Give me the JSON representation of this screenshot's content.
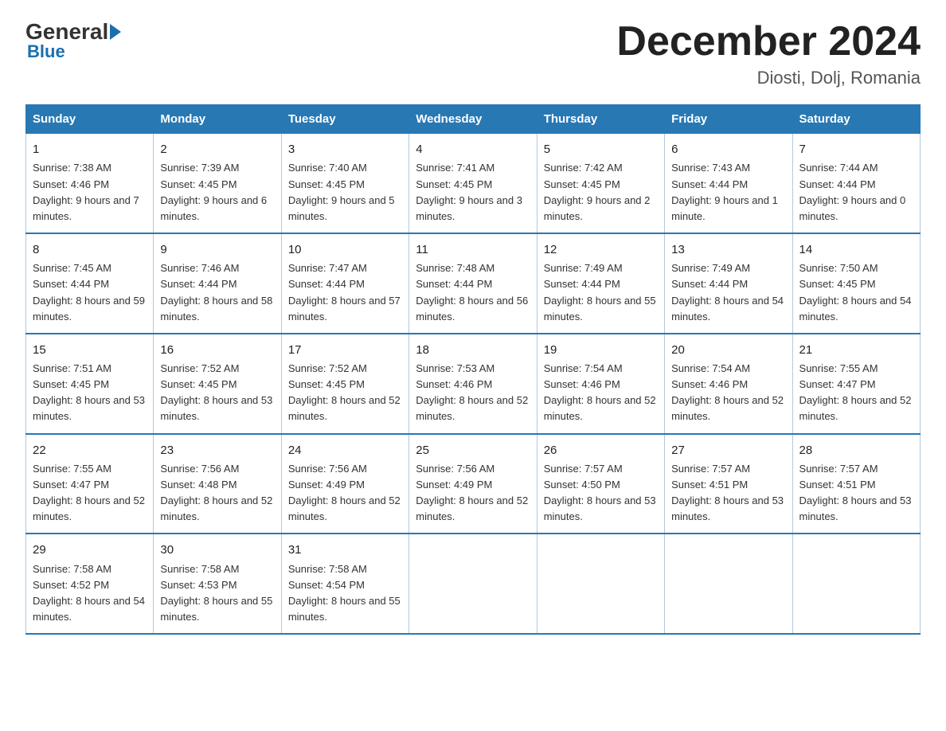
{
  "header": {
    "logo_general": "General",
    "logo_blue": "Blue",
    "title": "December 2024",
    "location": "Diosti, Dolj, Romania"
  },
  "days_of_week": [
    "Sunday",
    "Monday",
    "Tuesday",
    "Wednesday",
    "Thursday",
    "Friday",
    "Saturday"
  ],
  "weeks": [
    [
      {
        "day": "1",
        "sunrise": "7:38 AM",
        "sunset": "4:46 PM",
        "daylight": "9 hours and 7 minutes."
      },
      {
        "day": "2",
        "sunrise": "7:39 AM",
        "sunset": "4:45 PM",
        "daylight": "9 hours and 6 minutes."
      },
      {
        "day": "3",
        "sunrise": "7:40 AM",
        "sunset": "4:45 PM",
        "daylight": "9 hours and 5 minutes."
      },
      {
        "day": "4",
        "sunrise": "7:41 AM",
        "sunset": "4:45 PM",
        "daylight": "9 hours and 3 minutes."
      },
      {
        "day": "5",
        "sunrise": "7:42 AM",
        "sunset": "4:45 PM",
        "daylight": "9 hours and 2 minutes."
      },
      {
        "day": "6",
        "sunrise": "7:43 AM",
        "sunset": "4:44 PM",
        "daylight": "9 hours and 1 minute."
      },
      {
        "day": "7",
        "sunrise": "7:44 AM",
        "sunset": "4:44 PM",
        "daylight": "9 hours and 0 minutes."
      }
    ],
    [
      {
        "day": "8",
        "sunrise": "7:45 AM",
        "sunset": "4:44 PM",
        "daylight": "8 hours and 59 minutes."
      },
      {
        "day": "9",
        "sunrise": "7:46 AM",
        "sunset": "4:44 PM",
        "daylight": "8 hours and 58 minutes."
      },
      {
        "day": "10",
        "sunrise": "7:47 AM",
        "sunset": "4:44 PM",
        "daylight": "8 hours and 57 minutes."
      },
      {
        "day": "11",
        "sunrise": "7:48 AM",
        "sunset": "4:44 PM",
        "daylight": "8 hours and 56 minutes."
      },
      {
        "day": "12",
        "sunrise": "7:49 AM",
        "sunset": "4:44 PM",
        "daylight": "8 hours and 55 minutes."
      },
      {
        "day": "13",
        "sunrise": "7:49 AM",
        "sunset": "4:44 PM",
        "daylight": "8 hours and 54 minutes."
      },
      {
        "day": "14",
        "sunrise": "7:50 AM",
        "sunset": "4:45 PM",
        "daylight": "8 hours and 54 minutes."
      }
    ],
    [
      {
        "day": "15",
        "sunrise": "7:51 AM",
        "sunset": "4:45 PM",
        "daylight": "8 hours and 53 minutes."
      },
      {
        "day": "16",
        "sunrise": "7:52 AM",
        "sunset": "4:45 PM",
        "daylight": "8 hours and 53 minutes."
      },
      {
        "day": "17",
        "sunrise": "7:52 AM",
        "sunset": "4:45 PM",
        "daylight": "8 hours and 52 minutes."
      },
      {
        "day": "18",
        "sunrise": "7:53 AM",
        "sunset": "4:46 PM",
        "daylight": "8 hours and 52 minutes."
      },
      {
        "day": "19",
        "sunrise": "7:54 AM",
        "sunset": "4:46 PM",
        "daylight": "8 hours and 52 minutes."
      },
      {
        "day": "20",
        "sunrise": "7:54 AM",
        "sunset": "4:46 PM",
        "daylight": "8 hours and 52 minutes."
      },
      {
        "day": "21",
        "sunrise": "7:55 AM",
        "sunset": "4:47 PM",
        "daylight": "8 hours and 52 minutes."
      }
    ],
    [
      {
        "day": "22",
        "sunrise": "7:55 AM",
        "sunset": "4:47 PM",
        "daylight": "8 hours and 52 minutes."
      },
      {
        "day": "23",
        "sunrise": "7:56 AM",
        "sunset": "4:48 PM",
        "daylight": "8 hours and 52 minutes."
      },
      {
        "day": "24",
        "sunrise": "7:56 AM",
        "sunset": "4:49 PM",
        "daylight": "8 hours and 52 minutes."
      },
      {
        "day": "25",
        "sunrise": "7:56 AM",
        "sunset": "4:49 PM",
        "daylight": "8 hours and 52 minutes."
      },
      {
        "day": "26",
        "sunrise": "7:57 AM",
        "sunset": "4:50 PM",
        "daylight": "8 hours and 53 minutes."
      },
      {
        "day": "27",
        "sunrise": "7:57 AM",
        "sunset": "4:51 PM",
        "daylight": "8 hours and 53 minutes."
      },
      {
        "day": "28",
        "sunrise": "7:57 AM",
        "sunset": "4:51 PM",
        "daylight": "8 hours and 53 minutes."
      }
    ],
    [
      {
        "day": "29",
        "sunrise": "7:58 AM",
        "sunset": "4:52 PM",
        "daylight": "8 hours and 54 minutes."
      },
      {
        "day": "30",
        "sunrise": "7:58 AM",
        "sunset": "4:53 PM",
        "daylight": "8 hours and 55 minutes."
      },
      {
        "day": "31",
        "sunrise": "7:58 AM",
        "sunset": "4:54 PM",
        "daylight": "8 hours and 55 minutes."
      },
      null,
      null,
      null,
      null
    ]
  ]
}
